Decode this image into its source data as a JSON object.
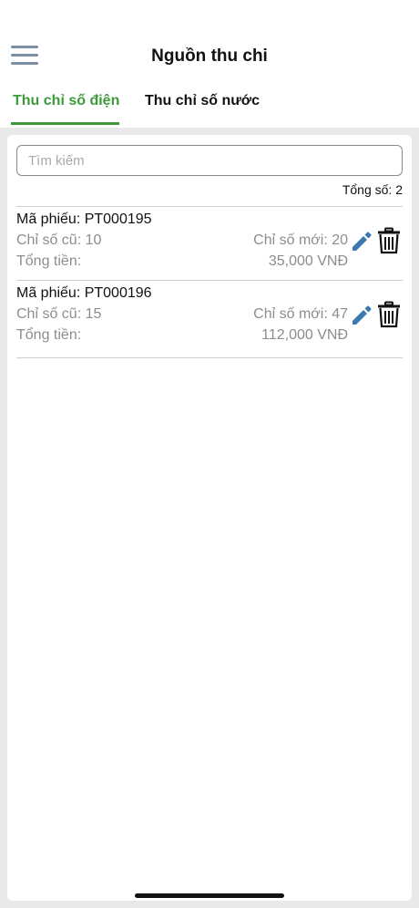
{
  "header": {
    "title": "Nguồn thu chi"
  },
  "tabs": [
    {
      "label": "Thu chỉ số điện",
      "active": true
    },
    {
      "label": "Thu chỉ số nước",
      "active": false
    }
  ],
  "search": {
    "placeholder": "Tìm kiếm",
    "value": ""
  },
  "summary": {
    "total_label": "Tổng số: 2"
  },
  "records": [
    {
      "code": "Mã phiếu: PT000195",
      "old_index": "Chỉ số cũ: 10",
      "new_index": "Chỉ số mới: 20",
      "total_label": "Tổng tiền:",
      "total_value": "35,000 VNĐ"
    },
    {
      "code": "Mã phiếu: PT000196",
      "old_index": "Chỉ số cũ: 15",
      "new_index": "Chỉ số mới: 47",
      "total_label": "Tổng tiền:",
      "total_value": "112,000 VNĐ"
    }
  ],
  "icons": {
    "menu": "hamburger-icon",
    "edit": "pencil-icon",
    "delete": "trash-icon"
  },
  "colors": {
    "accent": "#3c9a3a",
    "edit_icon": "#3b78b0",
    "muted_text": "#8d8d8d",
    "background": "#e9e9e9"
  }
}
